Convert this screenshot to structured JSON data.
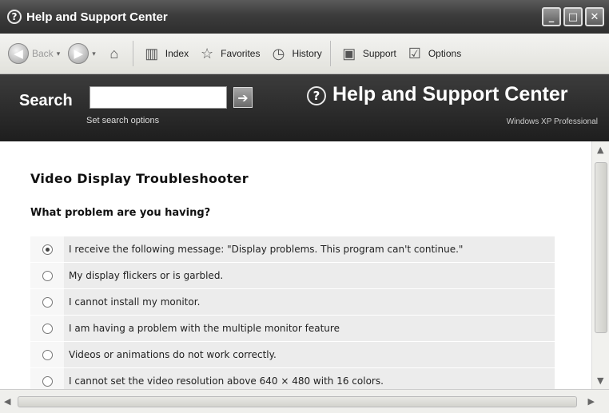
{
  "window": {
    "title": "Help and Support Center"
  },
  "toolbar": {
    "back_label": "Back",
    "index_label": "Index",
    "favorites_label": "Favorites",
    "history_label": "History",
    "support_label": "Support",
    "options_label": "Options"
  },
  "header": {
    "search_label": "Search",
    "search_value": "",
    "set_search_options": "Set search options",
    "brand_title": "Help and Support Center",
    "edition": "Windows XP Professional"
  },
  "content": {
    "title": "Video Display Troubleshooter",
    "question": "What problem are you having?",
    "options": [
      {
        "label": "I receive the following message: \"Display problems. This program can't continue.\"",
        "selected": true
      },
      {
        "label": "My display flickers or is garbled.",
        "selected": false
      },
      {
        "label": "I cannot install my monitor.",
        "selected": false
      },
      {
        "label": "I am having a problem with the multiple monitor feature",
        "selected": false
      },
      {
        "label": "Videos or animations do not work correctly.",
        "selected": false
      },
      {
        "label": "I cannot set the video resolution above 640 × 480 with 16 colors.",
        "selected": false
      }
    ]
  },
  "icons": {
    "help": "question-circle-icon",
    "back": "back-arrow-icon",
    "forward": "forward-arrow-icon",
    "home": "home-icon",
    "index": "book-icon",
    "favorites": "star-icon",
    "history": "clock-icon",
    "support": "support-icon",
    "options": "checklist-icon"
  }
}
